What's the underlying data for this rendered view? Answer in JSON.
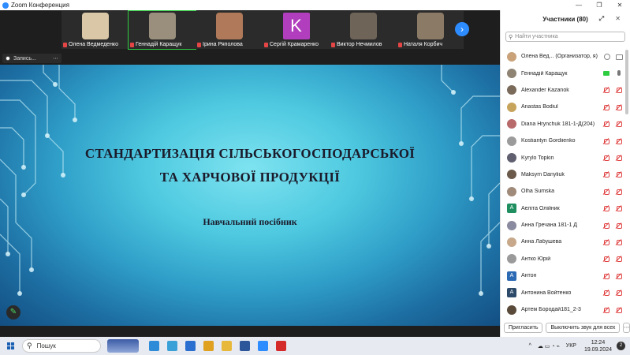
{
  "window": {
    "title": "Zoom Конференция",
    "minimize": "—",
    "restore": "❐",
    "close": "✕"
  },
  "thumbnails": [
    {
      "name": "Олена Ведмеденко",
      "face_color": "#d9c7a8",
      "active": false
    },
    {
      "name": "Геннадій Каращук",
      "face_color": "#9a8f7c",
      "active": true
    },
    {
      "name": "Ірина Ряполова",
      "face_color": "#b07a5a",
      "active": false
    },
    {
      "name": "Сергій Крамаренко",
      "initial": "K",
      "active": false
    },
    {
      "name": "Виктор Нечмилов",
      "face_color": "#6e6458",
      "active": false
    },
    {
      "name": "Наталя Корбич",
      "face_color": "#8b7a66",
      "active": false
    }
  ],
  "next_arrow": "›",
  "recording": {
    "label": "Запись...",
    "more": "⋯"
  },
  "slide": {
    "title_line1": "СТАНДАРТИЗАЦІЯ СІЛЬСЬКОГОСПОДАРСЬКОЇ",
    "title_line2": "ТА ХАРЧОВОЇ ПРОДУКЦІЇ",
    "subtitle": "Навчальний посібник",
    "edit_icon": "✎"
  },
  "participants": {
    "header": "Участники (80)",
    "header_icons": "⤢ ✕",
    "search_placeholder": "Найти участника",
    "search_icon": "⚲",
    "list": [
      {
        "name": "Олена Вед... (Организатор, я)",
        "avatar": "#c9a27a",
        "mic": "host-mic",
        "cam": "host-cam"
      },
      {
        "name": "Геннадій Каращук",
        "avatar": "#8f8473",
        "mic": "cam-on",
        "cam": "mic-on"
      },
      {
        "name": "Alexander Kazanok",
        "avatar": "#7a6a5a",
        "mic": "mic-off",
        "cam": "cam-off"
      },
      {
        "name": "Anastas Bodiul",
        "avatar": "#c7a45c",
        "mic": "mic-off",
        "cam": "cam-off"
      },
      {
        "name": "Diana Hrynchuk 181-1-Д(204)",
        "avatar": "#b86a6a",
        "mic": "mic-off",
        "cam": "cam-off"
      },
      {
        "name": "Kostiantyn Gordiienko",
        "avatar": "#9b9b9b",
        "mic": "mic-off",
        "cam": "cam-off"
      },
      {
        "name": "Kyrylo Topkin",
        "avatar": "#5f5f6f",
        "mic": "mic-off",
        "cam": "cam-off"
      },
      {
        "name": "Maksym Danyliuk",
        "avatar": "#6b5a4a",
        "mic": "mic-off",
        "cam": "cam-off"
      },
      {
        "name": "Olha Sumska",
        "avatar": "#a08a7a",
        "mic": "mic-off",
        "cam": "cam-off"
      },
      {
        "name": "Аеліта Олійник",
        "letter": "A",
        "avatar": "#1f8f5f",
        "mic": "mic-off",
        "cam": "cam-off"
      },
      {
        "name": "Анна Гречана 181-1 Д",
        "avatar": "#8a8aa0",
        "mic": "mic-off",
        "cam": "cam-off"
      },
      {
        "name": "Анна Лабушева",
        "avatar": "#c7a88a",
        "mic": "mic-off",
        "cam": "cam-off"
      },
      {
        "name": "Антко Юрій",
        "avatar": "#9a9a9a",
        "mic": "mic-off",
        "cam": "cam-off"
      },
      {
        "name": "Антон",
        "letter": "A",
        "avatar": "#2d6ab4",
        "mic": "mic-off",
        "cam": "cam-off"
      },
      {
        "name": "Антонина Войтенко",
        "letter": "A",
        "avatar": "#2d4a6a",
        "mic": "mic-off",
        "cam": "cam-off"
      },
      {
        "name": "Артем Бородай181_2-3",
        "avatar": "#5a4a3a",
        "mic": "mic-off",
        "cam": "cam-off"
      }
    ],
    "invite_label": "Пригласить",
    "mute_all_label": "Выключить звук для всех",
    "more_label": "⋯"
  },
  "taskbar": {
    "search_label": "Пошук",
    "search_icon": "⚲",
    "apps": [
      {
        "name": "edge",
        "color": "#2e8bd8"
      },
      {
        "name": "photos",
        "color": "#3aa0d8"
      },
      {
        "name": "mail",
        "color": "#2a6fd0"
      },
      {
        "name": "chrome",
        "color": "#e0a020"
      },
      {
        "name": "files",
        "color": "#e8b83a"
      },
      {
        "name": "word",
        "color": "#2b579a"
      },
      {
        "name": "zoom",
        "color": "#2d8cff"
      },
      {
        "name": "acrobat",
        "color": "#d42a2a"
      }
    ],
    "tray_chevron": "^",
    "tray_icons": "☁ ▭ ◔ ⌁",
    "lang": "УКР",
    "time": "12:24",
    "date": "19.09.2024",
    "notif_count": "2"
  }
}
